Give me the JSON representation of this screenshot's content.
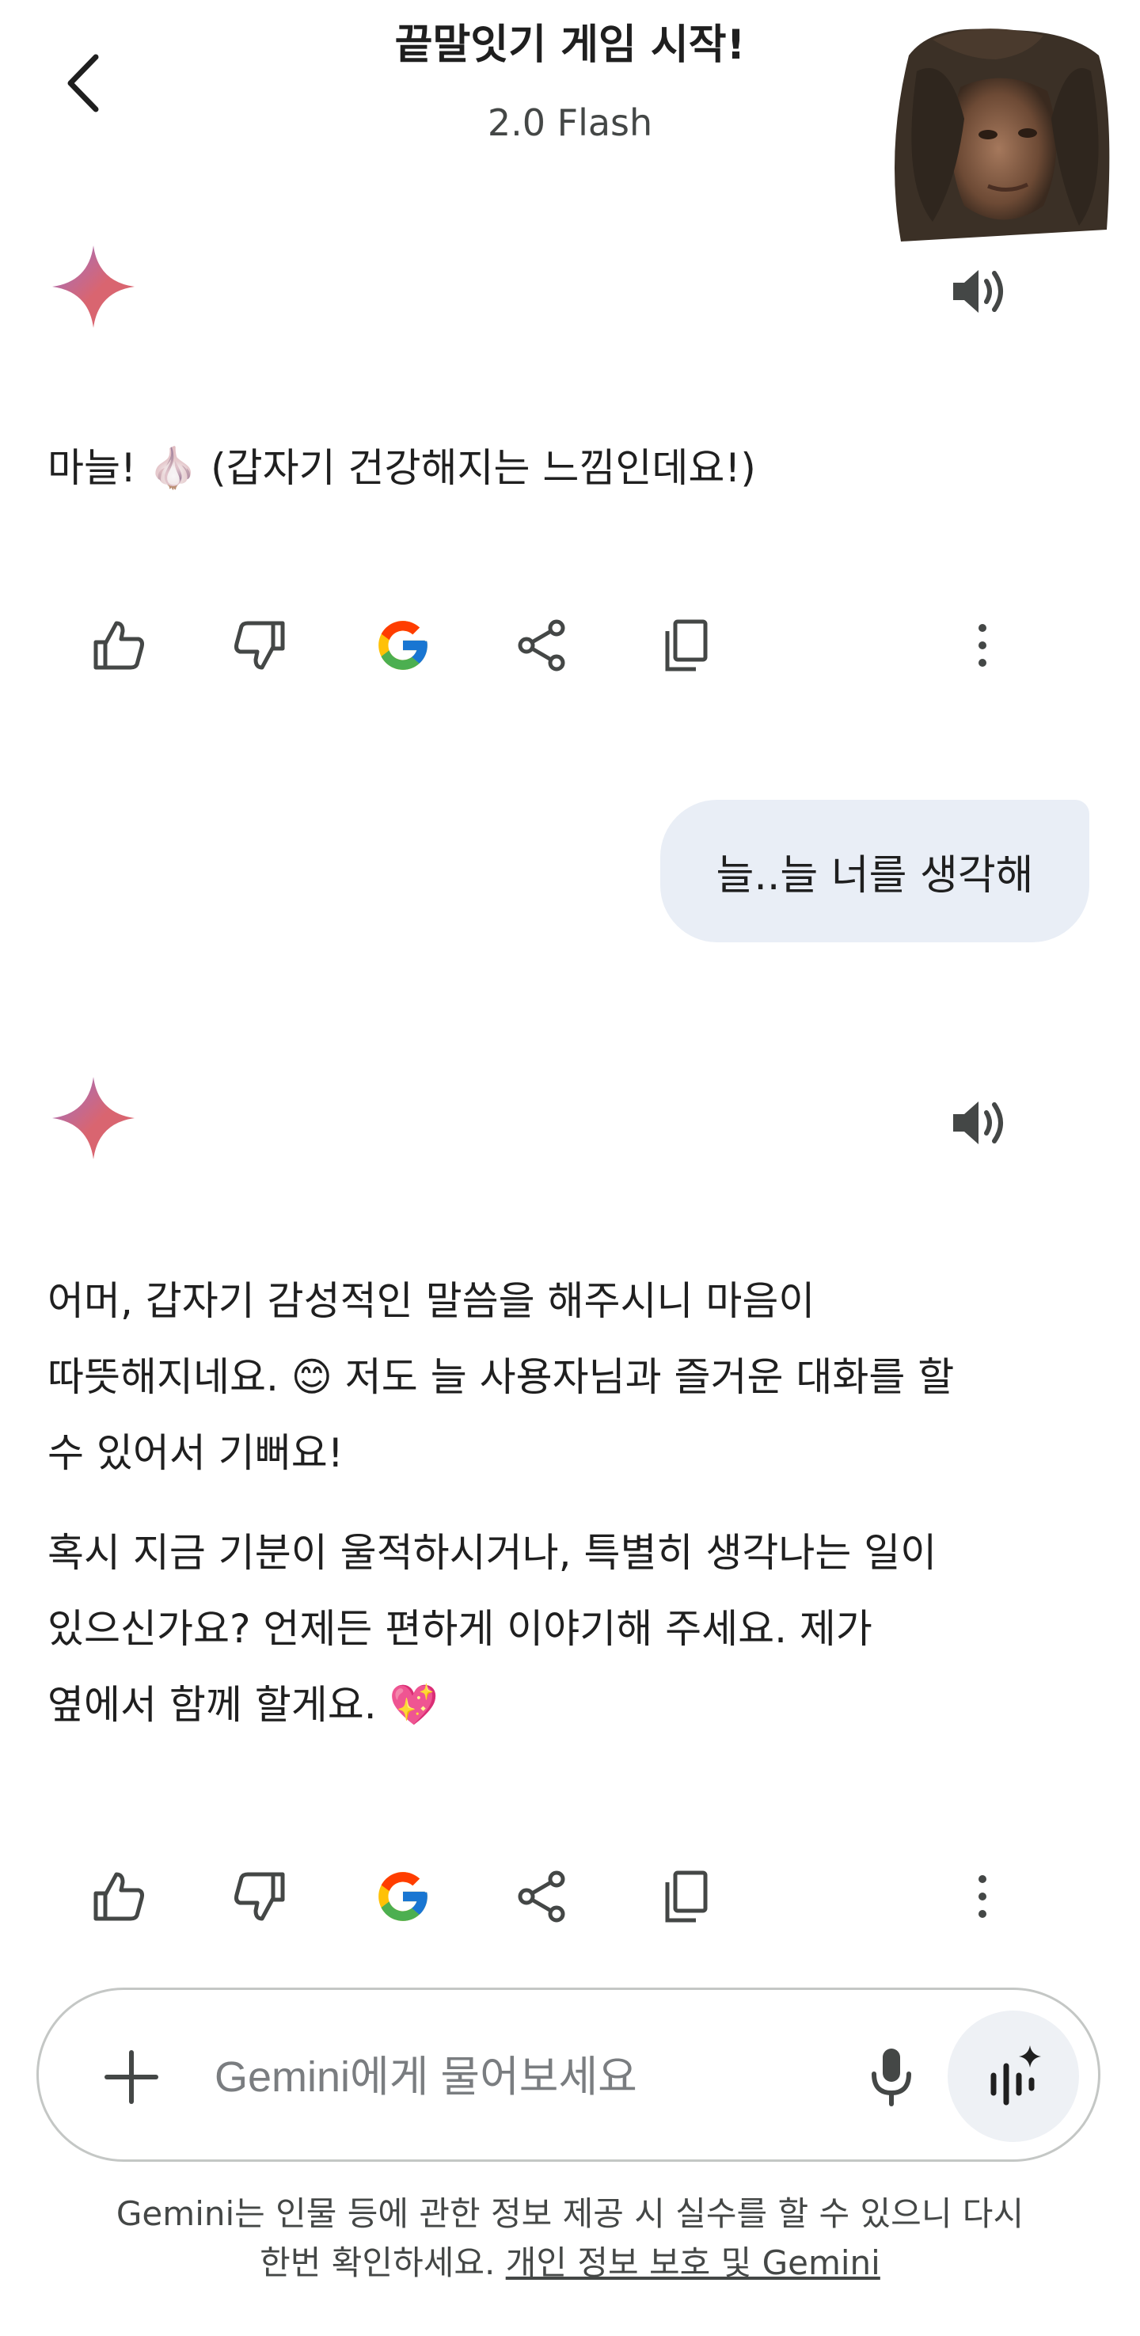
{
  "header": {
    "title": "끝말잇기 게임 시작!",
    "model": "2.0 Flash"
  },
  "messages": [
    {
      "role": "model",
      "paragraphs": [
        "마늘! 🧄 (갑자기 건강해지는 느낌인데요!)"
      ]
    },
    {
      "role": "user",
      "text": "늘..늘 너를 생각해"
    },
    {
      "role": "model",
      "paragraphs": [
        [
          "어머, 갑자기 감성적인 말씀을 해주시니 마음이",
          "따뜻해지네요. 😊 저도 늘 사용자님과 즐거운 대화를 할",
          "수 있어서 기뻐요!"
        ],
        [
          "혹시 지금 기분이 울적하시거나, 특별히 생각나는 일이",
          "있으신가요? 언제든 편하게 이야기해 주세요. 제가",
          "옆에서 함께 할게요. 💖"
        ]
      ]
    }
  ],
  "actions": [
    "thumbs-up-icon",
    "thumbs-down-icon",
    "google-icon",
    "share-icon",
    "copy-icon",
    "more-vert-icon"
  ],
  "composer": {
    "placeholder": "Gemini에게 물어보세요"
  },
  "disclaimer": {
    "line1": "Gemini는 인물 등에 관한 정보 제공 시 실수를 할 수 있으니 다시",
    "line2": "한번 확인하세요.",
    "link": "개인 정보 보호 및 Gemini"
  },
  "colors": {
    "bubble": "#e9eef6",
    "text": "#1f1f1f",
    "muted": "#444746",
    "gemini_star_a": "#d96570",
    "gemini_star_b": "#9b72cb"
  }
}
